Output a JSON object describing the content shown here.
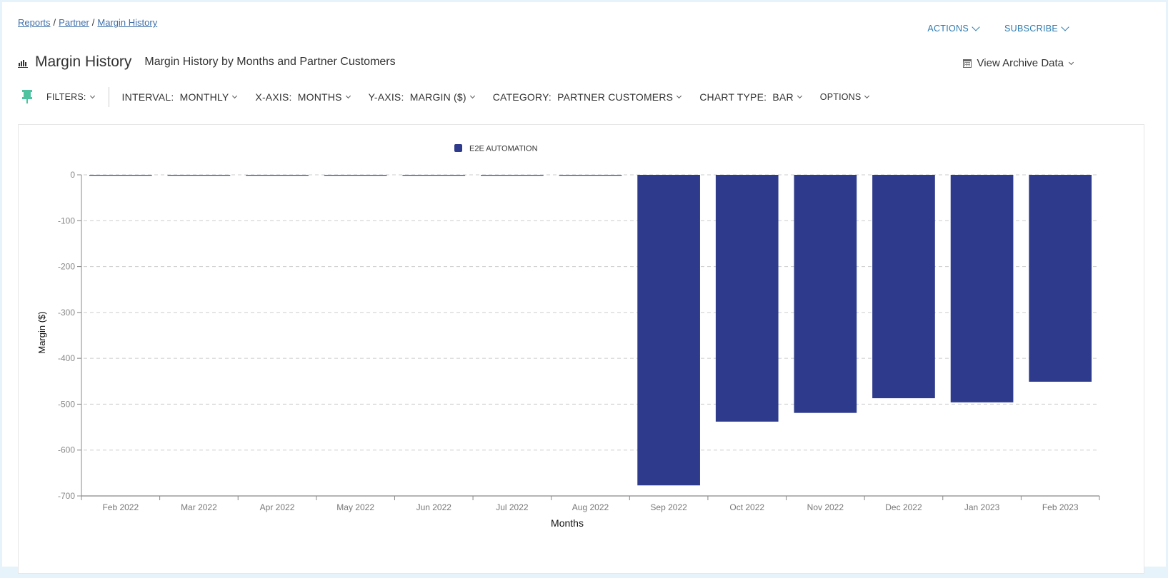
{
  "breadcrumb": {
    "items": [
      "Reports",
      "Partner",
      "Margin History"
    ],
    "separator": "/"
  },
  "top_actions": {
    "actions_label": "ACTIONS",
    "subscribe_label": "SUBSCRIBE"
  },
  "header": {
    "title": "Margin History",
    "subtitle": "Margin History by Months and Partner Customers",
    "icon": "bar-chart-icon",
    "archive_label": "View Archive Data",
    "archive_icon": "calendar-icon"
  },
  "filters": {
    "pin_icon": "pin-icon",
    "filters_label": "FILTERS:",
    "interval": "INTERVAL:  MONTHLY",
    "x_axis": "X-AXIS:  MONTHS",
    "y_axis": "Y-AXIS:  MARGIN ($)",
    "category": "CATEGORY:  PARTNER CUSTOMERS",
    "chart_type": "CHART TYPE:  BAR",
    "options": "OPTIONS"
  },
  "colors": {
    "bar": "#2e3b8c",
    "link": "#3e6fa8",
    "action": "#2a7ab0",
    "pin": "#4fc2a0",
    "grid": "#cccccc",
    "axis": "#888888"
  },
  "chart_data": {
    "type": "bar",
    "title": "",
    "xlabel": "Months",
    "ylabel": "Margin ($)",
    "categories": [
      "Feb 2022",
      "Mar 2022",
      "Apr 2022",
      "May 2022",
      "Jun 2022",
      "Jul 2022",
      "Aug 2022",
      "Sep 2022",
      "Oct 2022",
      "Nov 2022",
      "Dec 2022",
      "Jan 2023",
      "Feb 2023"
    ],
    "series": [
      {
        "name": "E2E AUTOMATION",
        "values": [
          0,
          0,
          0,
          0,
          0,
          0,
          0,
          -677,
          -538,
          -519,
          -487,
          -496,
          -451
        ]
      }
    ],
    "ylim": [
      -700,
      0
    ],
    "yticks": [
      0,
      -100,
      -200,
      -300,
      -400,
      -500,
      -600,
      -700
    ],
    "grid": true,
    "legend_position": "top-center"
  }
}
